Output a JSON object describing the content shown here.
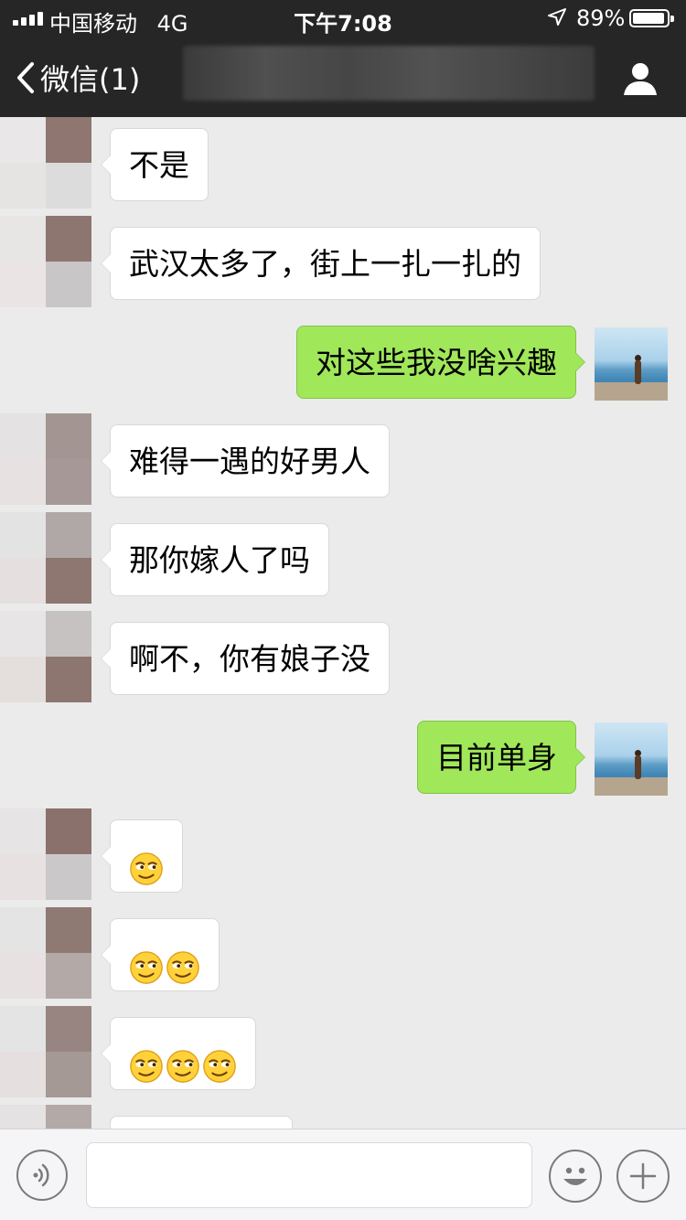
{
  "status_bar": {
    "carrier": "中国移动",
    "network": "4G",
    "time": "下午7:08",
    "battery": "89%"
  },
  "nav": {
    "back_label": "微信(1)"
  },
  "messages": [
    {
      "side": "in",
      "text": "不是"
    },
    {
      "side": "in",
      "text": "武汉太多了，街上一扎一扎的"
    },
    {
      "side": "out",
      "text": "对这些我没啥兴趣"
    },
    {
      "side": "in",
      "text": "难得一遇的好男人"
    },
    {
      "side": "in",
      "text": "那你嫁人了吗"
    },
    {
      "side": "in",
      "text": "啊不，你有娘子没"
    },
    {
      "side": "out",
      "text": "目前单身"
    },
    {
      "side": "in",
      "emoji_count": 1,
      "emoji": "smirk-emoji"
    },
    {
      "side": "in",
      "emoji_count": 2,
      "emoji": "smirk-emoji"
    },
    {
      "side": "in",
      "emoji_count": 3,
      "emoji": "smirk-emoji"
    }
  ],
  "colors": {
    "nav_bg": "#262626",
    "chat_bg": "#ebebeb",
    "incoming_bubble": "#ffffff",
    "outgoing_bubble": "#a0e75a"
  },
  "input_bar": {
    "icons": [
      "voice-icon",
      "emoji-icon",
      "plus-icon"
    ]
  }
}
